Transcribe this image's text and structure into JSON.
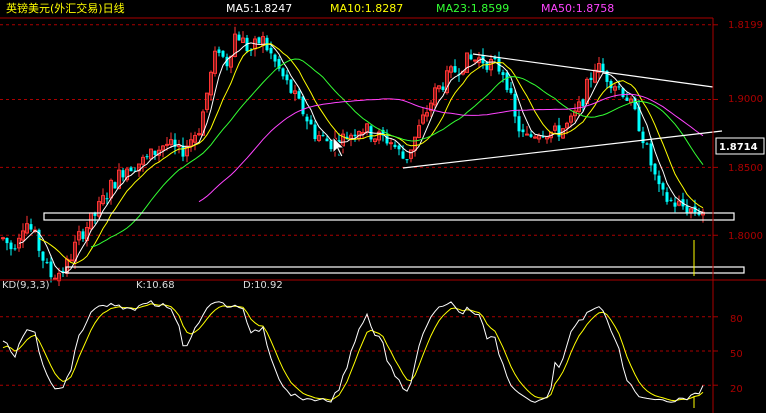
{
  "header": {
    "title": "英镑美元(外汇交易)日线",
    "ma": [
      {
        "label": "MA5:1.8247",
        "color": "#ffffff"
      },
      {
        "label": "MA10:1.8287",
        "color": "#ffff00"
      },
      {
        "label": "MA23:1.8599",
        "color": "#33ff33"
      },
      {
        "label": "MA50:1.8758",
        "color": "#ff44ff"
      }
    ]
  },
  "colors": {
    "up": "#ff3333",
    "down": "#00ffff",
    "grid": "#aa0000",
    "axis": "#aa0000",
    "trend": "#ffffff",
    "kd_k": "#ffffff",
    "kd_d": "#ffff00"
  },
  "price_axis": {
    "ticks": [
      {
        "label": "1.8199",
        "value": 1.955
      },
      {
        "label": "1.9000",
        "value": 1.9
      },
      {
        "label": "1.8500",
        "value": 1.85
      },
      {
        "label": "1.8000",
        "value": 1.8
      }
    ],
    "current": "1.8714",
    "current_value": 1.8714,
    "ylim": [
      1.77,
      1.96
    ]
  },
  "kd": {
    "label": "KD(9,3,3)",
    "k_label": "K:10.68",
    "d_label": "D:10.92",
    "ticks": [
      {
        "label": "80",
        "value": 80
      },
      {
        "label": "50",
        "value": 50
      },
      {
        "label": "20",
        "value": 20
      }
    ],
    "ylim": [
      0,
      100
    ]
  },
  "chart_data": {
    "type": "candlestick",
    "seed": 7,
    "keypoints": [
      [
        0,
        1.8
      ],
      [
        12,
        1.79
      ],
      [
        25,
        1.812
      ],
      [
        35,
        1.798
      ],
      [
        50,
        1.77
      ],
      [
        65,
        1.775
      ],
      [
        80,
        1.8
      ],
      [
        95,
        1.815
      ],
      [
        110,
        1.835
      ],
      [
        125,
        1.85
      ],
      [
        145,
        1.855
      ],
      [
        165,
        1.868
      ],
      [
        180,
        1.86
      ],
      [
        200,
        1.88
      ],
      [
        210,
        1.915
      ],
      [
        218,
        1.94
      ],
      [
        226,
        1.925
      ],
      [
        236,
        1.95
      ],
      [
        250,
        1.935
      ],
      [
        262,
        1.945
      ],
      [
        280,
        1.92
      ],
      [
        300,
        1.895
      ],
      [
        315,
        1.875
      ],
      [
        330,
        1.868
      ],
      [
        345,
        1.872
      ],
      [
        360,
        1.88
      ],
      [
        375,
        1.873
      ],
      [
        390,
        1.87
      ],
      [
        405,
        1.855
      ],
      [
        420,
        1.88
      ],
      [
        435,
        1.905
      ],
      [
        450,
        1.918
      ],
      [
        465,
        1.928
      ],
      [
        480,
        1.93
      ],
      [
        495,
        1.925
      ],
      [
        505,
        1.92
      ],
      [
        515,
        1.885
      ],
      [
        525,
        1.87
      ],
      [
        540,
        1.878
      ],
      [
        555,
        1.875
      ],
      [
        570,
        1.882
      ],
      [
        580,
        1.895
      ],
      [
        595,
        1.925
      ],
      [
        610,
        1.915
      ],
      [
        625,
        1.905
      ],
      [
        640,
        1.88
      ],
      [
        650,
        1.855
      ],
      [
        660,
        1.83
      ],
      [
        670,
        1.825
      ],
      [
        680,
        1.822
      ],
      [
        695,
        1.818
      ]
    ],
    "trendlines": [
      [
        [
          473,
          54
        ],
        [
          713,
          87
        ]
      ],
      [
        [
          403,
          168
        ],
        [
          722,
          131
        ]
      ]
    ],
    "support_rects": [
      {
        "x1": 44,
        "y1": 213,
        "x2": 734,
        "y2": 220
      },
      {
        "x1": 66,
        "y1": 267,
        "x2": 744,
        "y2": 273
      }
    ]
  }
}
